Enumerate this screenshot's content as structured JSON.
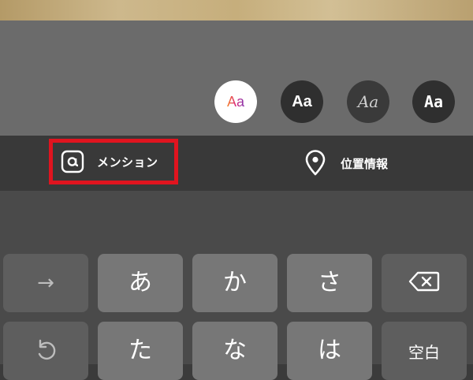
{
  "font_styles": [
    {
      "label": "Aa",
      "style": "modern",
      "selected": true
    },
    {
      "label": "Aa",
      "style": "classic"
    },
    {
      "label": "Aa",
      "style": "script"
    },
    {
      "label": "Aa",
      "style": "typewriter"
    }
  ],
  "sticker_bar": {
    "mention_label": "メンション",
    "location_label": "位置情報"
  },
  "keyboard": {
    "row1": {
      "arrow": "→",
      "a": "あ",
      "ka": "か",
      "sa": "さ",
      "backspace_icon": "backspace-icon"
    },
    "row2": {
      "undo_icon": "undo-icon",
      "ta": "た",
      "na": "な",
      "ha": "は",
      "space": "空白"
    }
  },
  "colors": {
    "highlight_border": "#e0141f",
    "overlay": "#6b6b6b",
    "bar": "#393939"
  }
}
